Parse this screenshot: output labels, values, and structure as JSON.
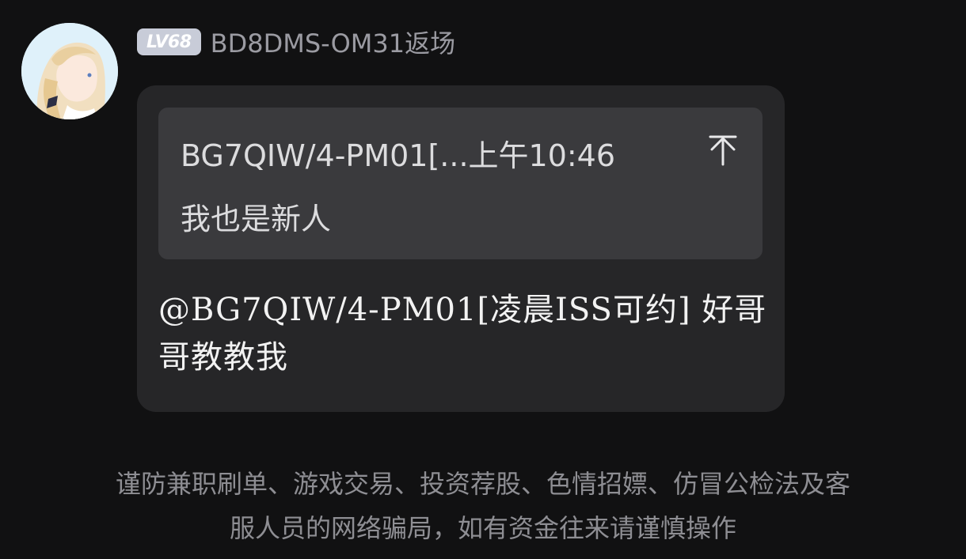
{
  "sender": {
    "level": "LV68",
    "name": "BD8DMS-OM31返场"
  },
  "quote": {
    "header": "BG7QIW/4-PM01[...上午10:46",
    "body": "我也是新人",
    "icon": "to-top-icon"
  },
  "message": {
    "text": "@BG7QIW/4-PM01[凌晨ISS可约] 好哥哥教教我"
  },
  "warning": {
    "line1": "谨防兼职刷单、游戏交易、投资荐股、色情招嫖、仿冒公检法及客",
    "line2": "服人员的网络骗局，如有资金往来请谨慎操作"
  },
  "colors": {
    "background": "#111112",
    "bubble": "#262628",
    "quote_card": "#3a3a3d",
    "badge": "#c8ccd8",
    "muted_text": "#8e8e93"
  }
}
